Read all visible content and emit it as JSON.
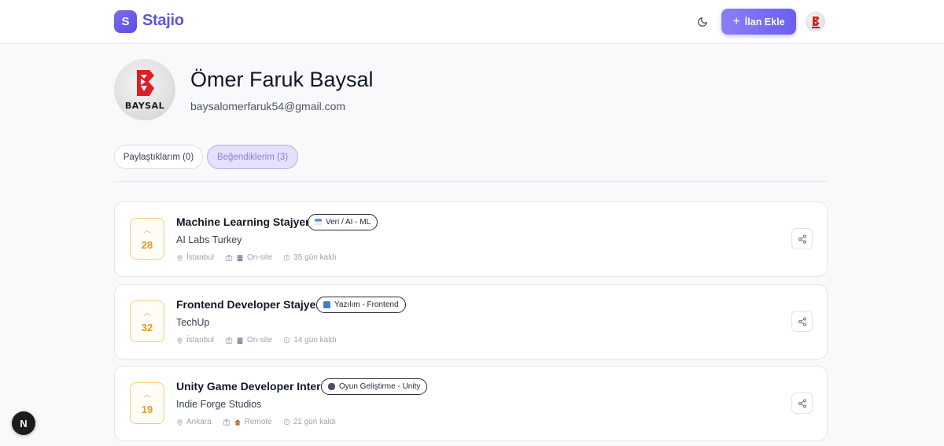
{
  "navbar": {
    "logo_letter": "S",
    "logo_text": "Stajio",
    "theme_icon": "moon-icon",
    "add_button_label": "İlan Ekle",
    "brand_color": "#5b54e6"
  },
  "profile": {
    "name": "Ömer Faruk Baysal",
    "email": "baysalomerfaruk54@gmail.com",
    "avatar_brand": "BAYSAL"
  },
  "tabs": [
    {
      "label": "Paylaştıklarım (0)",
      "active": false
    },
    {
      "label": "Beğendiklerim (3)",
      "active": true
    }
  ],
  "listings": [
    {
      "votes": "28",
      "title": "Machine Learning Stajyeri",
      "category": "Veri / AI - ML",
      "category_icon": "bar-chart-icon",
      "company": "AI Labs Turkey",
      "location": "İstanbul",
      "work_type": "On-site",
      "work_type_icon": "office-building-icon",
      "deadline": "35 gün kaldı"
    },
    {
      "votes": "32",
      "title": "Frontend Developer Stajyeri",
      "category": "Yazılım - Frontend",
      "category_icon": "blue-book-icon",
      "company": "TechUp",
      "location": "İstanbul",
      "work_type": "On-site",
      "work_type_icon": "office-building-icon",
      "deadline": "14 gün kaldı"
    },
    {
      "votes": "19",
      "title": "Unity Game Developer Intern",
      "category": "Oyun Geliştirme - Unity",
      "category_icon": "game-controller-icon",
      "company": "Indie Forge Studios",
      "location": "Ankara",
      "work_type": "Remote",
      "work_type_icon": "house-icon",
      "deadline": "21 gün kaldı"
    }
  ],
  "dev_badge": "N"
}
